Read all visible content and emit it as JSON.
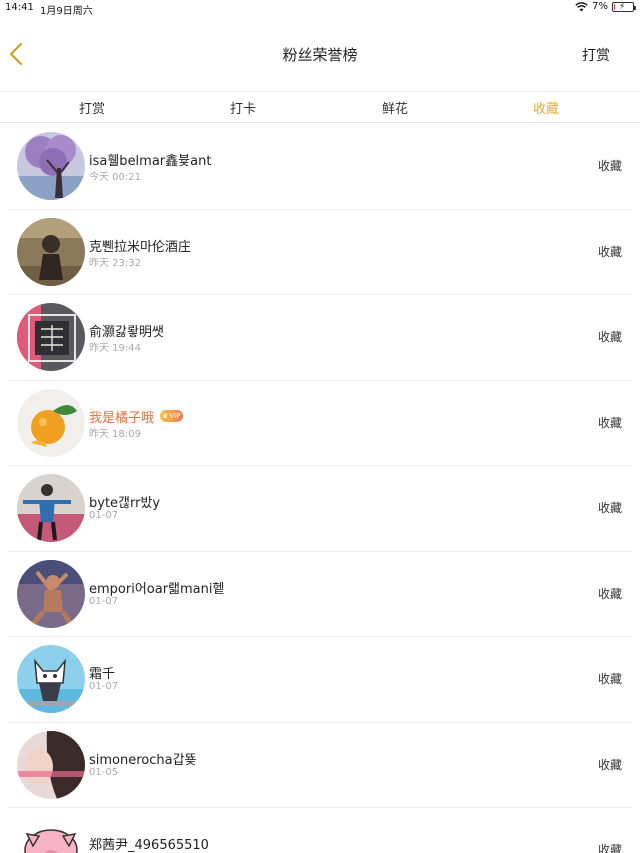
{
  "status_bar": {
    "time": "14:41",
    "date": "1月9日周六",
    "battery_text": "7%",
    "battery_level": 0.07
  },
  "nav": {
    "title": "粉丝荣誉榜",
    "action": "打赏"
  },
  "tabs": [
    {
      "label": "打赏",
      "active": false
    },
    {
      "label": "打卡",
      "active": false
    },
    {
      "label": "鲜花",
      "active": false
    },
    {
      "label": "收藏",
      "active": true
    }
  ],
  "colors": {
    "accent": "#e8a93a",
    "vip_name": "#e57342"
  },
  "fans": [
    {
      "name": "isa휄belmar鑫븇ant",
      "time": "今天 00:21",
      "action": "收藏",
      "vip": false,
      "avatar_icon": "purple-tree-avatar"
    },
    {
      "name": "克쀈拉米마伦酒庄",
      "time": "昨天 23:32",
      "action": "收藏",
      "vip": false,
      "avatar_icon": "dark-figure-avatar"
    },
    {
      "name": "俞灏갏뢓明쌧",
      "time": "昨天 19:44",
      "action": "收藏",
      "vip": false,
      "avatar_icon": "calligraphy-avatar"
    },
    {
      "name": "我是橘子哦",
      "time": "昨天 18:09",
      "action": "收藏",
      "vip": true,
      "vip_label": "VIP",
      "avatar_icon": "orange-fruit-avatar"
    },
    {
      "name": "byte갢rr밨y",
      "time": "01-07",
      "action": "收藏",
      "vip": false,
      "avatar_icon": "person-arms-out-avatar"
    },
    {
      "name": "empori어oar랣mani헽",
      "time": "01-07",
      "action": "收藏",
      "vip": false,
      "avatar_icon": "athlete-avatar"
    },
    {
      "name": "霜千",
      "time": "01-07",
      "action": "收藏",
      "vip": false,
      "avatar_icon": "cartoon-cat-avatar"
    },
    {
      "name": "simonerocha갑뚖",
      "time": "01-05",
      "action": "收藏",
      "vip": false,
      "avatar_icon": "portrait-avatar"
    },
    {
      "name": "郑茜尹_496565510",
      "time": "",
      "action": "收藏",
      "vip": false,
      "avatar_icon": "cartoon-pig-avatar"
    }
  ]
}
